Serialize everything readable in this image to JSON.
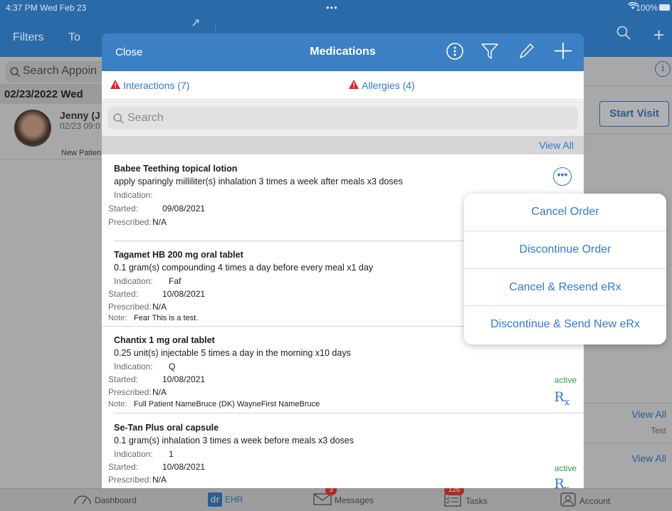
{
  "status_bar": {
    "time": "4:37 PM  Wed Feb 23",
    "battery": "100%"
  },
  "background": {
    "nav": {
      "filters": "Filters",
      "today": "To"
    },
    "search_placeholder": "Search Appoin",
    "date_header": "02/23/2022 Wed",
    "appointment": {
      "name": "Jenny (J",
      "time": "02/23 09:0",
      "type": "New Patien"
    },
    "start_visit": "Start Visit",
    "view_all_1": "View All",
    "test_label": "Test",
    "view_all_2": "View All"
  },
  "tabbar": {
    "tabs": [
      {
        "label": "Dashboard",
        "icon": "dashboard-gauge-icon"
      },
      {
        "label": "EHR",
        "icon": "dr-logo-icon"
      },
      {
        "label": "Messages",
        "icon": "envelope-icon",
        "badge": "3"
      },
      {
        "label": "Tasks",
        "icon": "checklist-icon",
        "badge": "126"
      },
      {
        "label": "Account",
        "icon": "account-icon"
      }
    ]
  },
  "modal": {
    "close": "Close",
    "title": "Medications",
    "header_icons": [
      "more-vertical-icon",
      "filter-icon",
      "edit-pencil-icon",
      "add-plus-icon"
    ],
    "interactions": "Interactions (7)",
    "allergies": "Allergies (4)",
    "search_placeholder": "Search",
    "view_all": "View All",
    "labels": {
      "indication": "Indication:",
      "started": "Started:",
      "prescribed": "Prescribed:",
      "note": "Note:"
    },
    "medications": [
      {
        "name": "Babee Teething topical lotion",
        "sig": "apply sparingly milliliter(s) inhalation 3 times a week after meals x3 doses",
        "indication": "",
        "started": "09/08/2021",
        "prescribed": "N/A"
      },
      {
        "name": "Tagamet HB 200 mg oral tablet",
        "sig": "0.1 gram(s) compounding 4 times a day before every meal x1 day",
        "indication": "Faf",
        "started": "10/08/2021",
        "prescribed": "N/A",
        "note": "Fear This is a test."
      },
      {
        "name": "Chantix 1 mg oral tablet",
        "sig": "0.25 unit(s) injectable 5 times a day in the morning x10 days",
        "indication": "Q",
        "started": "10/08/2021",
        "prescribed": "N/A",
        "note": "Full Patient NameBruce (DK) WayneFirst NameBruce",
        "status": "active"
      },
      {
        "name": "Se-Tan Plus oral capsule",
        "sig": "0.1 gram(s) inhalation 3 times a week before meals x3 doses",
        "indication": "1",
        "started": "10/08/2021",
        "prescribed": "N/A",
        "status": "active"
      }
    ],
    "rx_symbol": "R"
  },
  "popover": {
    "items": [
      "Cancel Order",
      "Discontinue Order",
      "Cancel & Resend eRx",
      "Discontinue & Send New eRx"
    ]
  },
  "colors": {
    "header_blue": "#3b7fc4",
    "link_blue": "#2f7ad0",
    "active_green": "#2ea043",
    "alert_red": "#e02020"
  }
}
